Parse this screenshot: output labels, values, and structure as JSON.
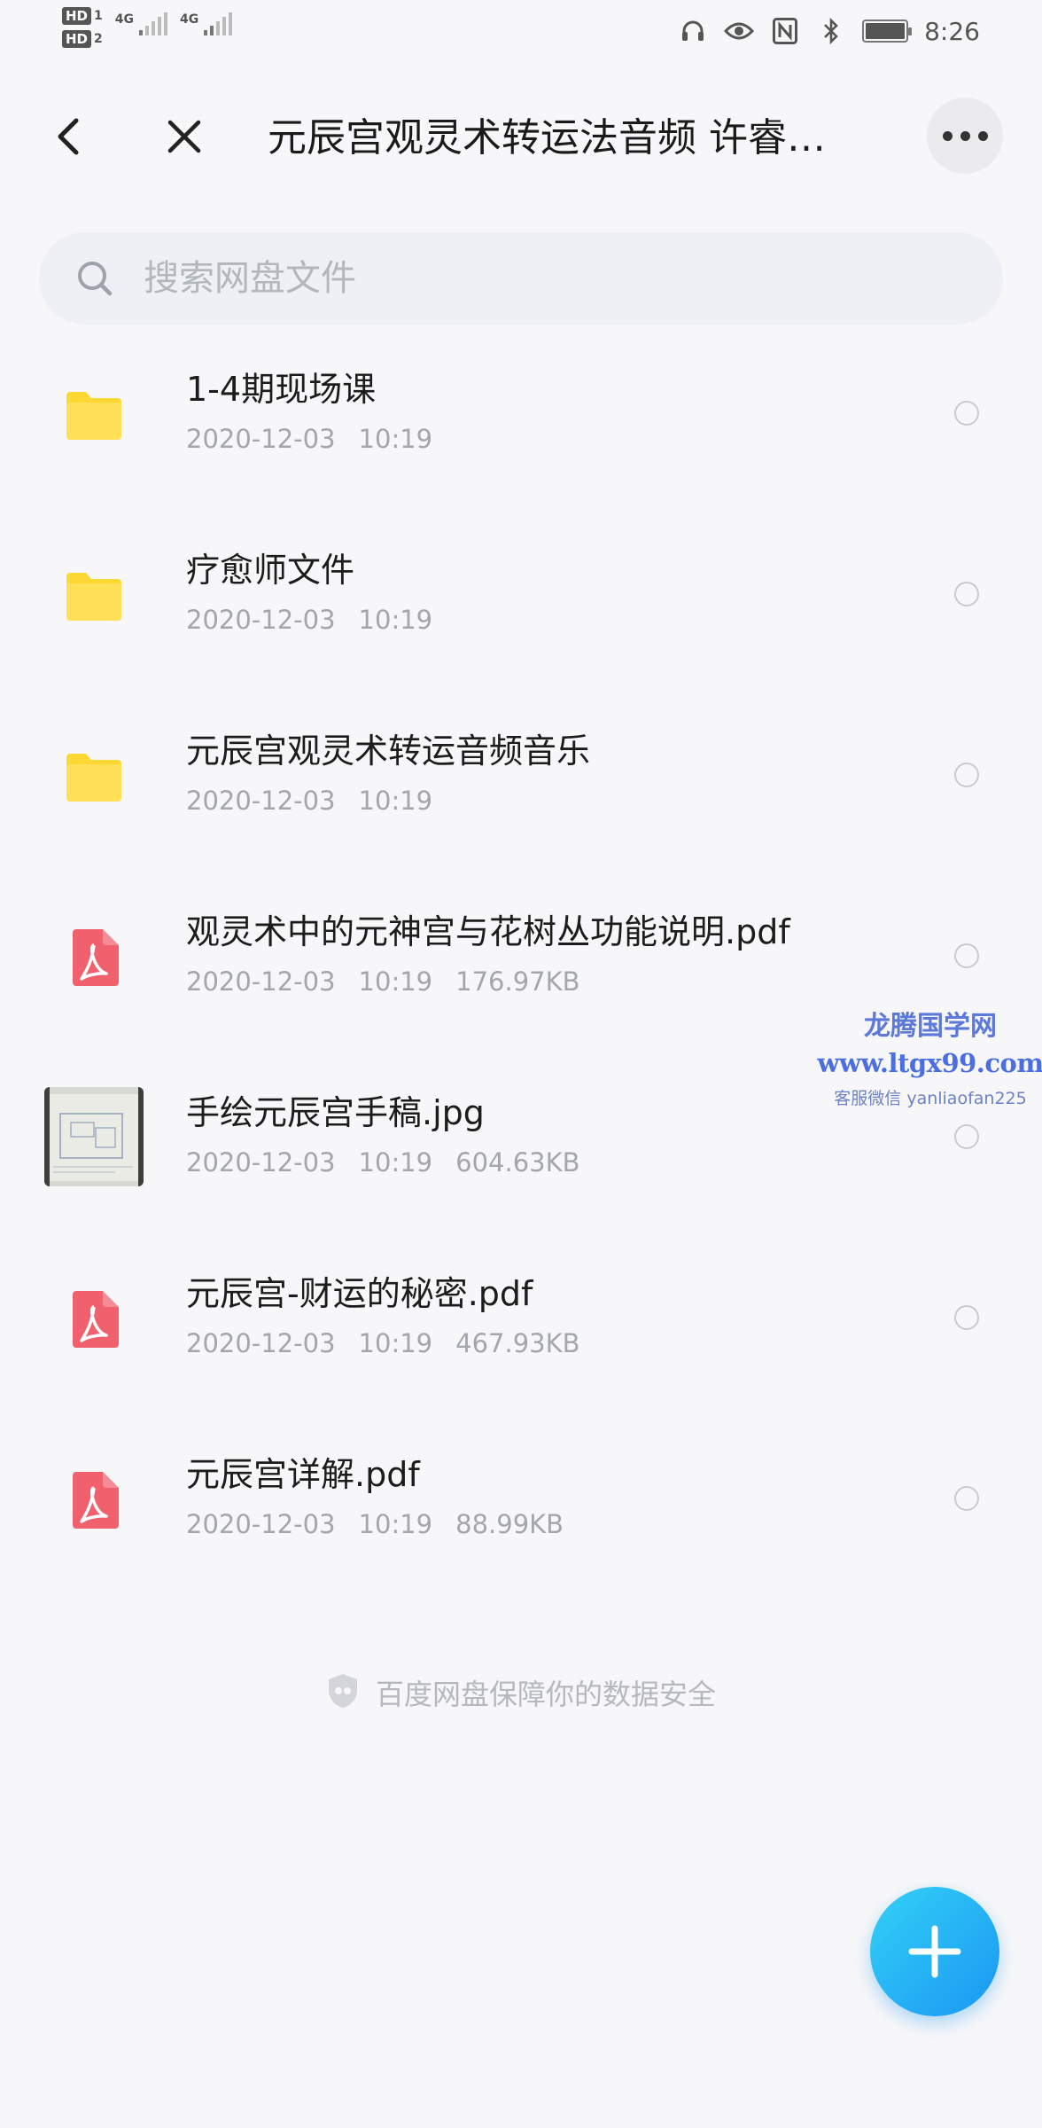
{
  "status_bar": {
    "sim1": {
      "label": "HD",
      "index": "1",
      "network": "4G"
    },
    "sim2": {
      "label": "HD",
      "index": "2",
      "network": "4G"
    },
    "time": "8:26",
    "icons": [
      "headset-icon",
      "eye-icon",
      "nfc-icon",
      "bluetooth-icon",
      "battery-icon"
    ]
  },
  "header": {
    "title": "元辰宫观灵术转运法音频 许睿…",
    "back_icon": "chevron-left-icon",
    "close_icon": "close-icon",
    "more_icon": "more-horizontal-icon"
  },
  "search": {
    "placeholder": "搜索网盘文件",
    "value": ""
  },
  "files": [
    {
      "name": "1-4期现场课",
      "date": "2020-12-03",
      "time": "10:19",
      "size": "",
      "type": "folder",
      "icon": "folder-icon"
    },
    {
      "name": "疗愈师文件",
      "date": "2020-12-03",
      "time": "10:19",
      "size": "",
      "type": "folder",
      "icon": "folder-icon"
    },
    {
      "name": "元辰宫观灵术转运音频音乐",
      "date": "2020-12-03",
      "time": "10:19",
      "size": "",
      "type": "folder",
      "icon": "folder-icon"
    },
    {
      "name": "观灵术中的元神宫与花树丛功能说明.pdf",
      "date": "2020-12-03",
      "time": "10:19",
      "size": "176.97KB",
      "type": "pdf",
      "icon": "pdf-icon"
    },
    {
      "name": "手绘元辰宫手稿.jpg",
      "date": "2020-12-03",
      "time": "10:19",
      "size": "604.63KB",
      "type": "image",
      "icon": "image-thumbnail"
    },
    {
      "name": "元辰宫-财运的秘密.pdf",
      "date": "2020-12-03",
      "time": "10:19",
      "size": "467.93KB",
      "type": "pdf",
      "icon": "pdf-icon"
    },
    {
      "name": "元辰宫详解.pdf",
      "date": "2020-12-03",
      "time": "10:19",
      "size": "88.99KB",
      "type": "pdf",
      "icon": "pdf-icon"
    }
  ],
  "watermark": {
    "line1": "龙腾国学网",
    "line2": "www.ltgx99.com",
    "line3": "客服微信 yanliaofan225"
  },
  "footer": {
    "text": "百度网盘保障你的数据安全",
    "icon": "shield-icon"
  },
  "fab": {
    "icon": "plus-icon"
  },
  "colors": {
    "background": "#f7f7f9",
    "folder": "#fdd835",
    "pdf": "#f0616d",
    "fab_start": "#33d2f7",
    "fab_end": "#1a96f2",
    "watermark": "#4b6fe0"
  }
}
